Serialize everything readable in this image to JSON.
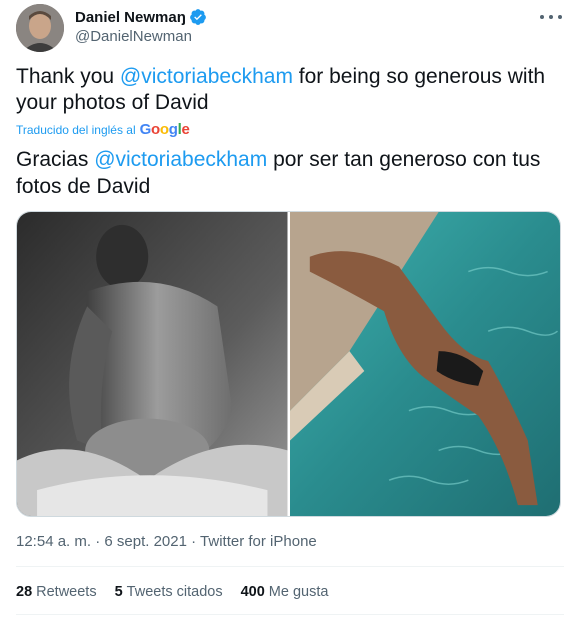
{
  "author": {
    "name": "Daniel Newmaŋ",
    "handle": "@DanielNewman"
  },
  "tweet": {
    "text_prefix": "Thank you ",
    "mention": "@victoriabeckham",
    "text_suffix": " for being so generous with your photos of David"
  },
  "translation": {
    "label": "Traducido del inglés al",
    "provider": "Google",
    "text_prefix": "Gracias ",
    "mention": "@victoriabeckham",
    "text_suffix": " por ser tan generoso con tus fotos de David"
  },
  "meta": {
    "time": "12:54 a. m.",
    "separator": "·",
    "date": "6 sept. 2021",
    "source": "Twitter for iPhone"
  },
  "stats": [
    {
      "count": "28",
      "label": "Retweets"
    },
    {
      "count": "5",
      "label": "Tweets citados"
    },
    {
      "count": "400",
      "label": "Me gusta"
    }
  ],
  "colors": {
    "link": "#1d9bf0",
    "secondary_text": "#536471",
    "verified": "#1d9bf0"
  },
  "icons": [
    "verified-badge-icon",
    "more-options-icon",
    "google-logo"
  ]
}
